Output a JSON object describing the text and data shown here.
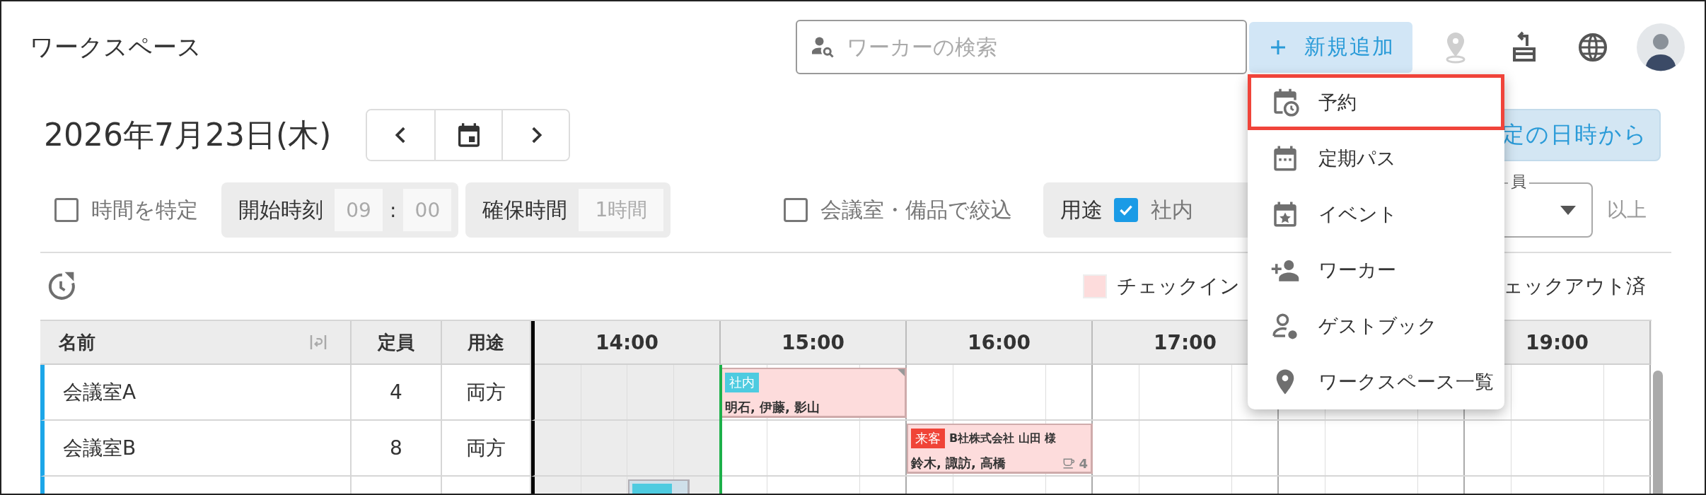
{
  "header": {
    "title": "ワークスペース",
    "search": {
      "placeholder": "ワーカーの検索"
    },
    "add_button": {
      "label": "新規追加"
    }
  },
  "date_bar": {
    "date": "2026年7月23日(木)",
    "from_datetime_button": {
      "label": "定の日時から"
    }
  },
  "filters": {
    "specify_time": {
      "label": "時間を特定",
      "checked": false
    },
    "start_time": {
      "label": "開始時刻",
      "hour": "09",
      "separator": ":",
      "minute": "00"
    },
    "duration": {
      "label": "確保時間",
      "value": "1時間"
    },
    "room_filter": {
      "label": "会議室・備品で絞込",
      "checked": false
    },
    "purpose": {
      "label": "用途",
      "options": [
        {
          "label": "社内",
          "checked": true
        }
      ]
    },
    "capacity": {
      "label": "員",
      "suffix": "以上"
    }
  },
  "legend": [
    {
      "label": "チェックイン",
      "color": "#fddcdc"
    },
    {
      "label": "ェックアウト済"
    }
  ],
  "table": {
    "columns": [
      "名前",
      "定員",
      "用途"
    ],
    "hours": [
      "14:00",
      "15:00",
      "16:00",
      "17:00",
      "19:00"
    ],
    "rows": [
      {
        "name": "会議室A",
        "capacity": "4",
        "purpose": "両方",
        "bookings": [
          {
            "color": "#fddcdc",
            "tag": {
              "label": "社内",
              "color": "#4ecbe0"
            },
            "names": "明石, 伊藤, 影山",
            "flagged": true
          }
        ]
      },
      {
        "name": "会議室B",
        "capacity": "8",
        "purpose": "両方",
        "bookings": [
          {
            "color": "#fddcdc",
            "tag": {
              "label": "来客",
              "color": "#f04438"
            },
            "title": "B社株式会社 山田 様",
            "names": "鈴木, 諏訪, 高橋",
            "drinks": "4",
            "flagged": false
          }
        ]
      },
      {
        "bookings": [
          {
            "color": "#cfe0ea",
            "tag": {
              "color": "#4ecbe0"
            }
          }
        ]
      }
    ]
  },
  "add_menu": {
    "items": [
      {
        "label": "予約",
        "highlighted": true
      },
      {
        "label": "定期パス",
        "highlighted": false
      },
      {
        "label": "イベント",
        "highlighted": false
      },
      {
        "label": "ワーカー",
        "highlighted": false
      },
      {
        "label": "ゲストブック",
        "highlighted": false
      },
      {
        "label": "ワークスペース一覧",
        "highlighted": false
      }
    ]
  }
}
